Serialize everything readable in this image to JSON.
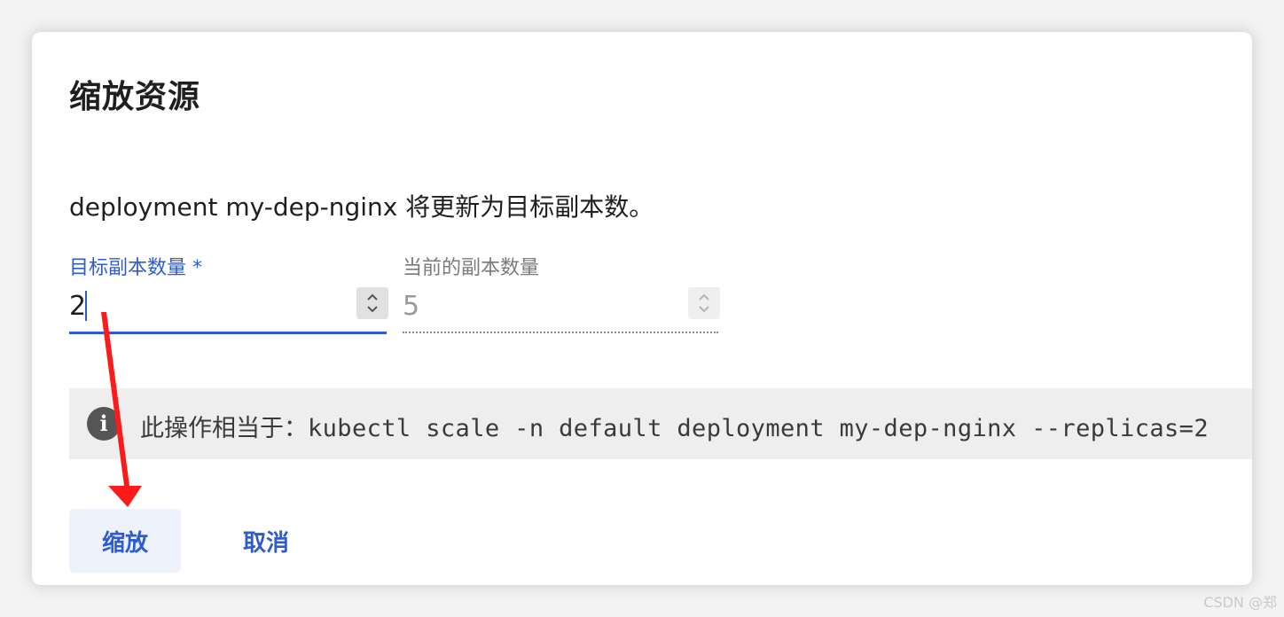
{
  "dialog": {
    "title": "缩放资源",
    "description": "deployment my-dep-nginx 将更新为目标副本数。"
  },
  "fields": {
    "target": {
      "label": "目标副本数量 *",
      "value": "2"
    },
    "current": {
      "label": "当前的副本数量",
      "value": "5"
    }
  },
  "info": {
    "prefix": "此操作相当于：",
    "command": "kubectl scale -n default deployment my-dep-nginx --replicas=2"
  },
  "actions": {
    "scale_label": "缩放",
    "cancel_label": "取消"
  },
  "watermark": "CSDN @郑",
  "colors": {
    "accent": "#2d5bd3",
    "annotation_arrow": "#ff1a1a"
  }
}
